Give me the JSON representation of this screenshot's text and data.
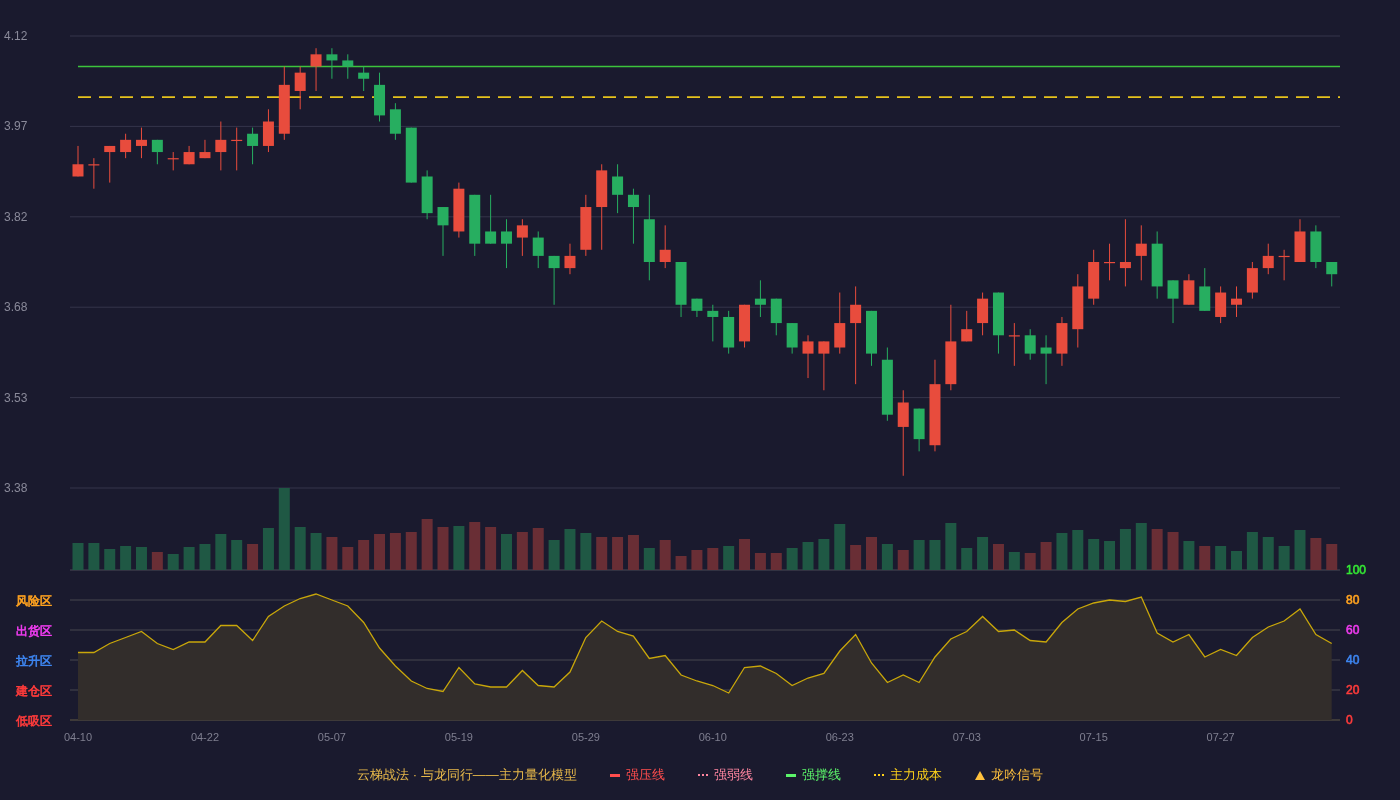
{
  "price_chart": {
    "chart_data": {
      "type": "candlestick",
      "ohlc": [
        [
          3.89,
          3.94,
          3.89,
          3.91
        ],
        [
          3.91,
          3.92,
          3.87,
          3.91
        ],
        [
          3.93,
          3.94,
          3.88,
          3.94
        ],
        [
          3.93,
          3.96,
          3.92,
          3.95
        ],
        [
          3.94,
          3.97,
          3.92,
          3.95
        ],
        [
          3.95,
          3.95,
          3.91,
          3.93
        ],
        [
          3.92,
          3.93,
          3.9,
          3.92
        ],
        [
          3.91,
          3.94,
          3.91,
          3.93
        ],
        [
          3.92,
          3.95,
          3.92,
          3.93
        ],
        [
          3.93,
          3.98,
          3.9,
          3.95
        ],
        [
          3.95,
          3.97,
          3.9,
          3.95
        ],
        [
          3.96,
          3.97,
          3.91,
          3.94
        ],
        [
          3.94,
          4.0,
          3.93,
          3.98
        ],
        [
          3.96,
          4.07,
          3.95,
          4.04
        ],
        [
          4.03,
          4.07,
          4.0,
          4.06
        ],
        [
          4.07,
          4.1,
          4.03,
          4.09
        ],
        [
          4.09,
          4.1,
          4.05,
          4.08
        ],
        [
          4.08,
          4.09,
          4.05,
          4.07
        ],
        [
          4.06,
          4.07,
          4.03,
          4.05
        ],
        [
          4.04,
          4.06,
          3.98,
          3.99
        ],
        [
          4.0,
          4.01,
          3.95,
          3.96
        ],
        [
          3.97,
          3.97,
          3.88,
          3.88
        ],
        [
          3.89,
          3.9,
          3.82,
          3.83
        ],
        [
          3.84,
          3.84,
          3.76,
          3.81
        ],
        [
          3.8,
          3.88,
          3.79,
          3.87
        ],
        [
          3.86,
          3.86,
          3.76,
          3.78
        ],
        [
          3.8,
          3.86,
          3.78,
          3.78
        ],
        [
          3.8,
          3.82,
          3.74,
          3.78
        ],
        [
          3.79,
          3.82,
          3.76,
          3.81
        ],
        [
          3.79,
          3.8,
          3.74,
          3.76
        ],
        [
          3.76,
          3.76,
          3.68,
          3.74
        ],
        [
          3.74,
          3.78,
          3.73,
          3.76
        ],
        [
          3.77,
          3.86,
          3.76,
          3.84
        ],
        [
          3.84,
          3.91,
          3.77,
          3.9
        ],
        [
          3.89,
          3.91,
          3.83,
          3.86
        ],
        [
          3.86,
          3.87,
          3.78,
          3.84
        ],
        [
          3.82,
          3.86,
          3.72,
          3.75
        ],
        [
          3.75,
          3.81,
          3.74,
          3.77
        ],
        [
          3.75,
          3.75,
          3.66,
          3.68
        ],
        [
          3.69,
          3.69,
          3.66,
          3.67
        ],
        [
          3.67,
          3.68,
          3.62,
          3.66
        ],
        [
          3.66,
          3.67,
          3.6,
          3.61
        ],
        [
          3.62,
          3.68,
          3.61,
          3.68
        ],
        [
          3.69,
          3.72,
          3.66,
          3.68
        ],
        [
          3.69,
          3.69,
          3.63,
          3.65
        ],
        [
          3.65,
          3.65,
          3.6,
          3.61
        ],
        [
          3.6,
          3.63,
          3.56,
          3.62
        ],
        [
          3.6,
          3.62,
          3.54,
          3.62
        ],
        [
          3.61,
          3.7,
          3.6,
          3.65
        ],
        [
          3.65,
          3.71,
          3.55,
          3.68
        ],
        [
          3.67,
          3.67,
          3.58,
          3.6
        ],
        [
          3.59,
          3.61,
          3.49,
          3.5
        ],
        [
          3.48,
          3.54,
          3.4,
          3.52
        ],
        [
          3.51,
          3.51,
          3.44,
          3.46
        ],
        [
          3.45,
          3.59,
          3.44,
          3.55
        ],
        [
          3.55,
          3.68,
          3.54,
          3.62
        ],
        [
          3.62,
          3.67,
          3.62,
          3.64
        ],
        [
          3.65,
          3.7,
          3.63,
          3.69
        ],
        [
          3.7,
          3.7,
          3.6,
          3.63
        ],
        [
          3.63,
          3.65,
          3.58,
          3.63
        ],
        [
          3.63,
          3.64,
          3.59,
          3.6
        ],
        [
          3.61,
          3.63,
          3.55,
          3.6
        ],
        [
          3.6,
          3.66,
          3.58,
          3.65
        ],
        [
          3.64,
          3.73,
          3.61,
          3.71
        ],
        [
          3.69,
          3.77,
          3.68,
          3.75
        ],
        [
          3.75,
          3.78,
          3.72,
          3.75
        ],
        [
          3.74,
          3.82,
          3.71,
          3.75
        ],
        [
          3.76,
          3.81,
          3.72,
          3.78
        ],
        [
          3.78,
          3.8,
          3.69,
          3.71
        ],
        [
          3.72,
          3.72,
          3.65,
          3.69
        ],
        [
          3.68,
          3.73,
          3.68,
          3.72
        ],
        [
          3.71,
          3.74,
          3.67,
          3.67
        ],
        [
          3.66,
          3.71,
          3.65,
          3.7
        ],
        [
          3.68,
          3.71,
          3.66,
          3.69
        ],
        [
          3.7,
          3.75,
          3.69,
          3.74
        ],
        [
          3.74,
          3.78,
          3.73,
          3.76
        ],
        [
          3.76,
          3.77,
          3.72,
          3.76
        ],
        [
          3.75,
          3.82,
          3.75,
          3.8
        ],
        [
          3.8,
          3.81,
          3.74,
          3.75
        ],
        [
          3.75,
          3.75,
          3.71,
          3.73
        ]
      ],
      "ylim": [
        3.38,
        4.12
      ],
      "yticks": [
        {
          "value": 4.12,
          "label": "4.12"
        },
        {
          "value": 3.972,
          "label": "3.97"
        },
        {
          "value": 3.824,
          "label": "3.82"
        },
        {
          "value": 3.676,
          "label": "3.68"
        },
        {
          "value": 3.528,
          "label": "3.53"
        },
        {
          "value": 3.38,
          "label": "3.38"
        }
      ],
      "grid": true,
      "ref_lines": [
        {
          "axis": "y",
          "value": 4.07,
          "color": "#3cc43c"
        },
        {
          "axis": "y",
          "value": 4.02,
          "color": "#e6c21c"
        }
      ]
    }
  },
  "oscillator": {
    "chart_data": {
      "type": "area",
      "categories": [
        "04-10",
        null,
        null,
        null,
        null,
        null,
        null,
        null,
        "04-22",
        null,
        null,
        null,
        null,
        null,
        null,
        null,
        "05-07",
        null,
        null,
        null,
        null,
        null,
        null,
        null,
        "05-19",
        null,
        null,
        null,
        null,
        null,
        null,
        null,
        "05-29",
        null,
        null,
        null,
        null,
        null,
        null,
        null,
        "06-10",
        null,
        null,
        null,
        null,
        null,
        null,
        null,
        "06-23",
        null,
        null,
        null,
        null,
        null,
        null,
        null,
        "07-03",
        null,
        null,
        null,
        null,
        null,
        null,
        null,
        "07-15",
        null,
        null,
        null,
        null,
        null,
        null,
        null,
        "07-27",
        null,
        null,
        null,
        null,
        null,
        null,
        null
      ],
      "values": [
        45,
        45,
        51,
        55,
        59,
        51,
        47,
        52,
        52,
        63,
        63,
        53,
        69,
        76,
        81,
        84,
        80,
        76,
        65,
        48,
        36,
        26,
        21,
        19,
        35,
        24,
        22,
        22,
        33,
        23,
        22,
        32,
        55,
        66,
        59,
        56,
        41,
        43,
        30,
        26,
        23,
        18,
        35,
        36,
        31,
        23,
        28,
        31,
        46,
        57,
        38,
        25,
        30,
        25,
        42,
        54,
        59,
        69,
        59,
        60,
        53,
        52,
        65,
        74,
        78,
        80,
        79,
        82,
        58,
        52,
        57,
        42,
        47,
        43,
        55,
        62,
        66,
        74,
        57,
        51
      ],
      "ylim": [
        0,
        100
      ],
      "yticks": [
        100,
        80,
        60,
        40,
        20,
        0
      ],
      "grid": true
    },
    "scale": [
      {
        "color": "#33e633"
      },
      {
        "color": "#ffa21f"
      },
      {
        "color": "#ee3bee"
      },
      {
        "color": "#3d85f0"
      },
      {
        "color": "#ff3b3b"
      },
      {
        "color": "#ff3b3b"
      }
    ],
    "zones": [
      {
        "label": "风险区",
        "color": "#ffa21f"
      },
      {
        "label": "出货区",
        "color": "#f23cf2"
      },
      {
        "label": "拉升区",
        "color": "#3d85f0"
      },
      {
        "label": "建仓区",
        "color": "#ff3b3b"
      },
      {
        "label": "低吸区",
        "color": "#ff3b3b"
      }
    ]
  },
  "legend": {
    "title": "云梯战法 · 与龙同行——主力量化模型",
    "items": [
      {
        "kind": "solid",
        "label": "强压线",
        "color": "#ff4d4d"
      },
      {
        "kind": "dashed",
        "label": "强弱线",
        "color": "#ff86a0"
      },
      {
        "kind": "solid",
        "label": "强撑线",
        "color": "#5cf56a"
      },
      {
        "kind": "dashed",
        "label": "主力成本",
        "color": "#ffd21a"
      },
      {
        "kind": "triangle",
        "label": "龙吟信号",
        "color": "#ffc13d"
      }
    ]
  }
}
